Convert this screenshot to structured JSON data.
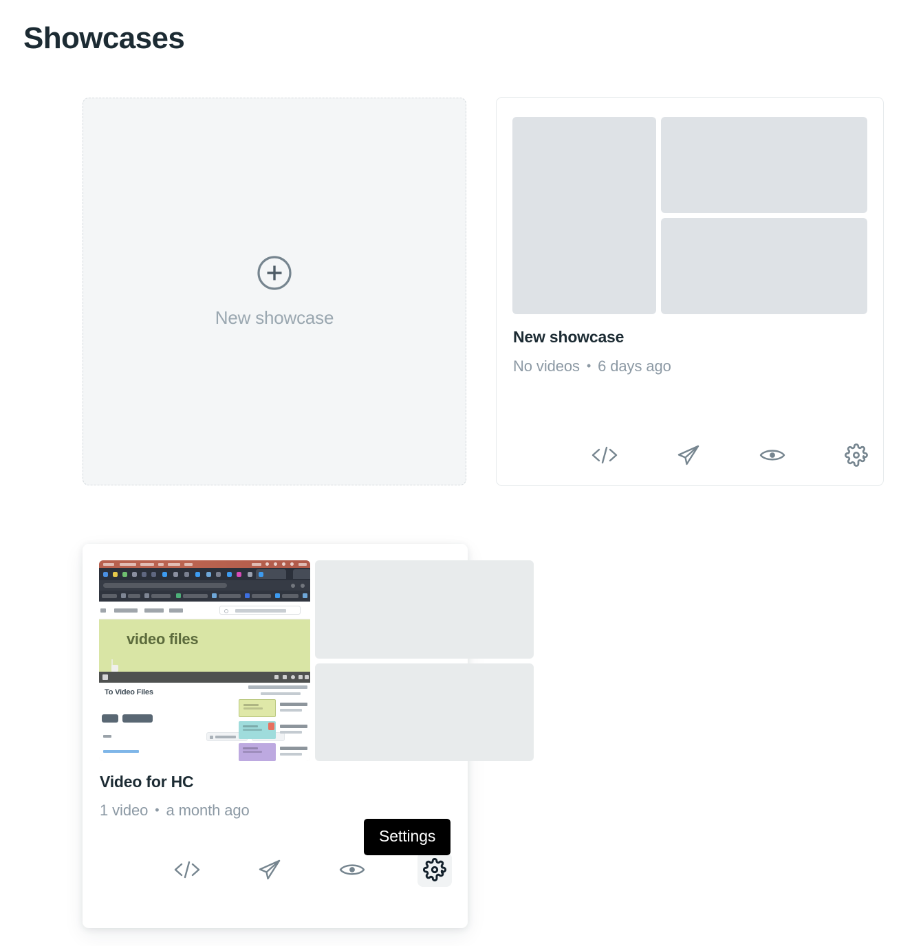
{
  "page": {
    "title": "Showcases"
  },
  "new_showcase_tile": {
    "label": "New showcase",
    "icon": "plus-circle-icon"
  },
  "action_labels": {
    "embed": "Embed",
    "share": "Share",
    "preview": "Preview",
    "settings": "Settings"
  },
  "tooltip": {
    "settings": "Settings"
  },
  "colors": {
    "title_text": "#1c2b33",
    "muted_text": "#8c99a4",
    "placeholder_fill": "#dee2e6",
    "placeholder_fill_alt": "#e8ebec",
    "dashed_border": "#d3d9dd",
    "card_border": "#e6eaec",
    "icon": "#76858f",
    "icon_hover": "#13202b",
    "icon_hover_bg": "#f1f3f4",
    "tooltip_bg": "#000000",
    "tooltip_text": "#ffffff",
    "tile_bg": "#f4f6f7"
  },
  "showcases": [
    {
      "id": "new-showcase",
      "title": "New showcase",
      "video_count": "No videos",
      "separator": "•",
      "updated": "6 days ago",
      "thumbnail_type": "placeholder",
      "actions": [
        {
          "name": "embed-code-icon",
          "label": "Embed",
          "hovered": false
        },
        {
          "name": "share-icon",
          "label": "Share",
          "hovered": false
        },
        {
          "name": "preview-eye-icon",
          "label": "Preview",
          "hovered": false
        },
        {
          "name": "settings-gear-icon",
          "label": "Settings",
          "hovered": false
        }
      ]
    },
    {
      "id": "video-hc",
      "title": "Video for HC",
      "video_count": "1 video",
      "separator": "•",
      "updated": "a month ago",
      "thumbnail_type": "screenshot",
      "thumbnail_text": {
        "video_heading": "video files",
        "page_heading": "To Video Files"
      },
      "actions": [
        {
          "name": "embed-code-icon",
          "label": "Embed",
          "hovered": false
        },
        {
          "name": "share-icon",
          "label": "Share",
          "hovered": false
        },
        {
          "name": "preview-eye-icon",
          "label": "Preview",
          "hovered": false
        },
        {
          "name": "settings-gear-icon",
          "label": "Settings",
          "hovered": true
        }
      ]
    }
  ]
}
